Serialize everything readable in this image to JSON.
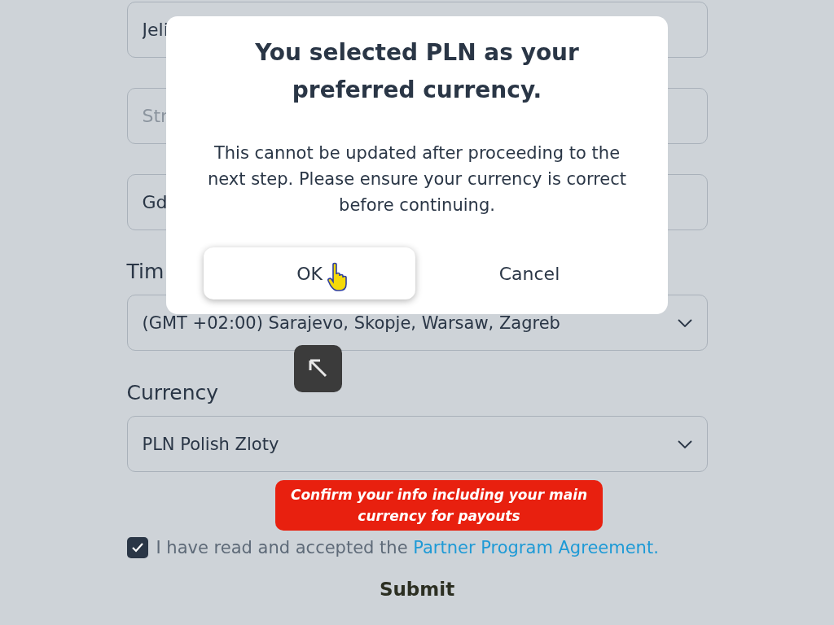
{
  "form": {
    "fields": [
      {
        "value": "Jeli"
      },
      {
        "placeholder": "Str"
      },
      {
        "value": "Gd"
      }
    ],
    "timezone": {
      "label": "Tim",
      "value": "(GMT +02:00) Sarajevo, Skopje, Warsaw, Zagreb"
    },
    "currency": {
      "label": "Currency",
      "value": "PLN Polish Zloty"
    },
    "agreement": {
      "checked": true,
      "text": "I have read and accepted the",
      "link": "Partner Program Agreement."
    },
    "submit": "Submit"
  },
  "dialog": {
    "title": "You selected PLN as your preferred currency.",
    "message": "This cannot be updated after proceeding to the next step. Please ensure your currency is correct before continuing.",
    "buttons": [
      {
        "label": "OK",
        "selected": true
      },
      {
        "label": "Cancel",
        "selected": false
      }
    ]
  },
  "caption": "Confirm your info including your main currency for payouts"
}
